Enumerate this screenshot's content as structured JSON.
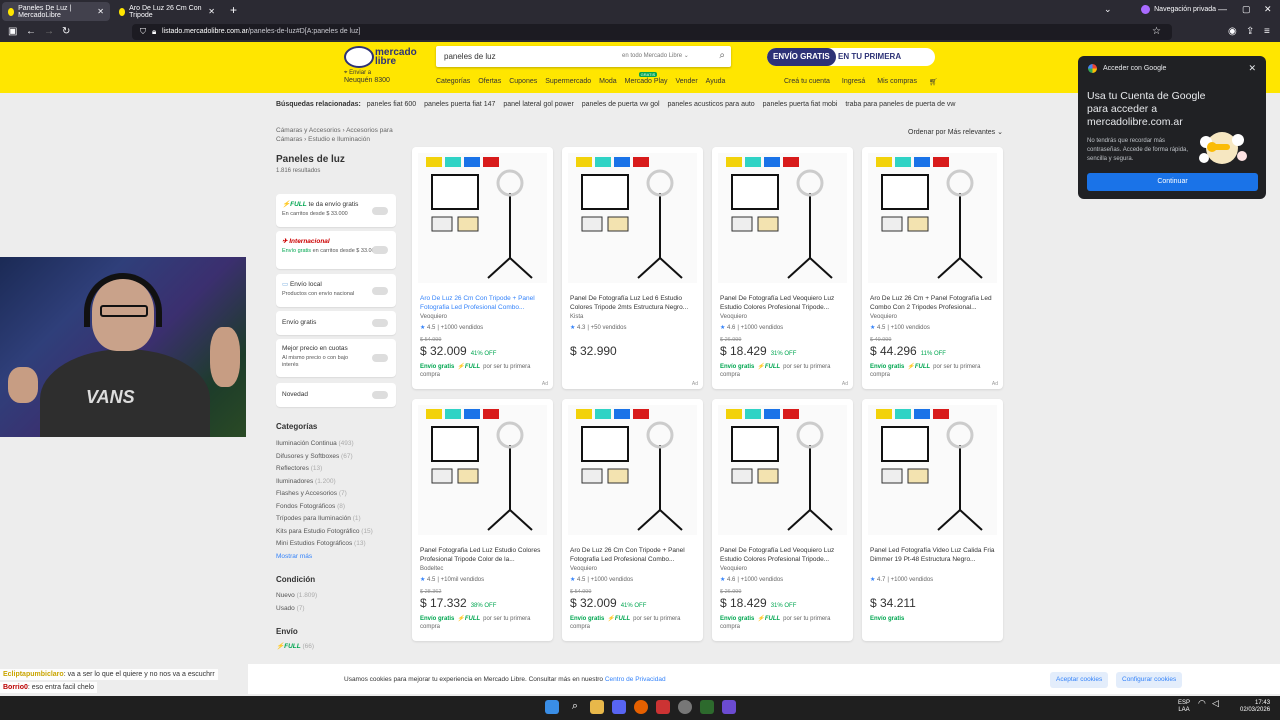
{
  "browser": {
    "tabs": [
      {
        "label": "Paneles De Luz | MercadoLibre",
        "active": true
      },
      {
        "label": "Aro De Luz 26 Cm Con Tripode",
        "active": false
      }
    ],
    "private_label": "Navegación privada",
    "url_host": "listado.mercadolibre.com.ar",
    "url_path": "/paneles-de-luz#D[A:paneles de luz]"
  },
  "header": {
    "logo_line1": "mercado",
    "logo_line2": "libre",
    "search_value": "paneles de luz",
    "search_scope": "en todo Mercado Libre",
    "promo_left": "ENVÍO GRATIS",
    "promo_right": "EN TU PRIMERA COMPRA",
    "loc_label": "Enviar a",
    "loc_value": "Neuquén 8300",
    "nav": [
      "Categorías",
      "Ofertas",
      "Cupones",
      "Supermercado",
      "Moda",
      "Mercado Play",
      "Vender",
      "Ayuda"
    ],
    "nav_badge": "GRATIS",
    "account": [
      "Creá tu cuenta",
      "Ingresá",
      "Mis compras"
    ]
  },
  "related": {
    "label": "Búsquedas relacionadas:",
    "items": [
      "paneles fiat 600",
      "paneles puerta fiat 147",
      "panel lateral gol power",
      "paneles de puerta vw gol",
      "paneles acusticos para auto",
      "paneles puerta fiat mobi",
      "traba para paneles de puerta de vw"
    ]
  },
  "crumbs": "Cámaras y Accesorios › Accesorios para Cámaras › Estudio e Iluminación",
  "page_title": "Paneles de luz",
  "results": "1.816 resultados",
  "order": {
    "label": "Ordenar por",
    "value": "Más relevantes"
  },
  "filters": {
    "full": {
      "brand": "⚡FULL",
      "text": "te da envío gratis",
      "sub": "En carritos desde $ 33.000"
    },
    "intl": {
      "brand": "✈ Internacional",
      "sub_g": "Envío gratis",
      "sub": "en carritos desde $ 33.000"
    },
    "local": {
      "title": "Envío local",
      "sub": "Productos con envío nacional"
    },
    "free": "Envío gratis",
    "best": {
      "title": "Mejor precio en cuotas",
      "sub": "Al mismo precio o con bajo interés"
    },
    "new": "Novedad"
  },
  "categories": {
    "title": "Categorías",
    "items": [
      [
        "Iluminación Continua",
        "(493)"
      ],
      [
        "Difusores y Softboxes",
        "(67)"
      ],
      [
        "Reflectores",
        "(13)"
      ],
      [
        "Iluminadores",
        "(1.200)"
      ],
      [
        "Flashes y Accesorios",
        "(7)"
      ],
      [
        "Fondos Fotográficos",
        "(8)"
      ],
      [
        "Trípodes para Iluminación",
        "(1)"
      ],
      [
        "Kits para Estudio Fotográfico",
        "(15)"
      ],
      [
        "Mini Estudios Fotográficos",
        "(13)"
      ]
    ],
    "more": "Mostrar más"
  },
  "condition": {
    "title": "Condición",
    "items": [
      [
        "Nuevo",
        "(1.809)"
      ],
      [
        "Usado",
        "(7)"
      ]
    ]
  },
  "shipping": {
    "title": "Envío",
    "full": "⚡FULL",
    "count": "(66)"
  },
  "products": [
    {
      "title": "Aro De Luz 26 Cm Con Tripode + Panel Fotografia Led Profesional Combo...",
      "seller": "Veoquiero",
      "rating": "4.5",
      "sold": "| +1000 vendidos",
      "old": "$ 54.999",
      "price": "$ 32.009",
      "off": "41% OFF",
      "ship": "Envío gratis",
      "full": "⚡FULL",
      "shiptail": "por ser tu primera compra"
    },
    {
      "title": "Panel De Fotografía Luz Led 6 Estudio Colores Tripode 2mts Estructura Negro...",
      "seller": "Kista",
      "rating": "4.3",
      "sold": "| +50 vendidos",
      "old": "",
      "price": "$ 32.990",
      "off": "",
      "ship": "",
      "full": "",
      "shiptail": ""
    },
    {
      "title": "Panel De Fotografía Led Veoquiero Luz Estudio Colores Profesional Tripode...",
      "seller": "Veoquiero",
      "rating": "4.6",
      "sold": "| +1000 vendidos",
      "old": "$ 26.999",
      "price": "$ 18.429",
      "off": "31% OFF",
      "ship": "Envío gratis",
      "full": "⚡FULL",
      "shiptail": "por ser tu primera compra"
    },
    {
      "title": "Aro De Luz 26 Cm + Panel Fotografía Led Combo Con 2 Tripodes Profesional...",
      "seller": "Veoquiero",
      "rating": "4.5",
      "sold": "| +100 vendidos",
      "old": "$ 49.999",
      "price": "$ 44.296",
      "off": "11% OFF",
      "ship": "Envío gratis",
      "full": "⚡FULL",
      "shiptail": "por ser tu primera compra"
    },
    {
      "title": "Panel Fotografia Led Luz Estudio Colores Profesional Tripode Color de la...",
      "seller": "Bodeltec",
      "rating": "4.5",
      "sold": "| +10mil vendidos",
      "old": "$ 28.362",
      "price": "$ 17.332",
      "off": "38% OFF",
      "ship": "Envío gratis",
      "full": "⚡FULL",
      "shiptail": "por ser tu primera compra"
    },
    {
      "title": "Aro De Luz 26 Cm Con Tripode + Panel Fotografia Led Profesional Combo...",
      "seller": "Veoquiero",
      "rating": "4.5",
      "sold": "| +1000 vendidos",
      "old": "$ 54.999",
      "price": "$ 32.009",
      "off": "41% OFF",
      "ship": "Envío gratis",
      "full": "⚡FULL",
      "shiptail": "por ser tu primera compra"
    },
    {
      "title": "Panel De Fotografía Led Veoquiero Luz Estudio Colores Profesional Tripode...",
      "seller": "Veoquiero",
      "rating": "4.6",
      "sold": "| +1000 vendidos",
      "old": "$ 26.999",
      "price": "$ 18.429",
      "off": "31% OFF",
      "ship": "Envío gratis",
      "full": "⚡FULL",
      "shiptail": "por ser tu primera compra"
    },
    {
      "title": "Panel Led Fotografía Video Luz Calida Fria Dimmer 19 Pt-48 Estructura Negro...",
      "seller": "",
      "rating": "4.7",
      "sold": "| +1000 vendidos",
      "old": "",
      "price": "$ 34.211",
      "off": "",
      "ship": "Envío gratis",
      "full": "",
      "shiptail": ""
    }
  ],
  "ad_label": "Ad",
  "google": {
    "header": "Acceder con Google",
    "title": "Usa tu Cuenta de Google para acceder a mercadolibre.com.ar",
    "desc": "No tendrás que recordar más contraseñas. Accede de forma rápida, sencilla y segura.",
    "button": "Continuar"
  },
  "cookie": {
    "text": "Usamos cookies para mejorar tu experiencia en Mercado Libre. Consultar más en nuestro",
    "link": "Centro de Privacidad",
    "accept": "Aceptar cookies",
    "config": "Configurar cookies"
  },
  "chat": [
    {
      "user": "Ecliptapumbiclaro",
      "msg": ": va a ser lo que el quiere y no nos va a escuchrr"
    },
    {
      "user": "Borrio0",
      "msg": ": eso entra facil chelo"
    }
  ],
  "webcam_shirt": "VANS",
  "taskbar": {
    "lang1": "ESP",
    "lang2": "LAA",
    "time": "17:43",
    "date": "02/03/2026"
  },
  "colors": {
    "yellow": "#ffe600",
    "navy": "#2d3277",
    "green": "#00a650",
    "blue": "#3483fa"
  }
}
